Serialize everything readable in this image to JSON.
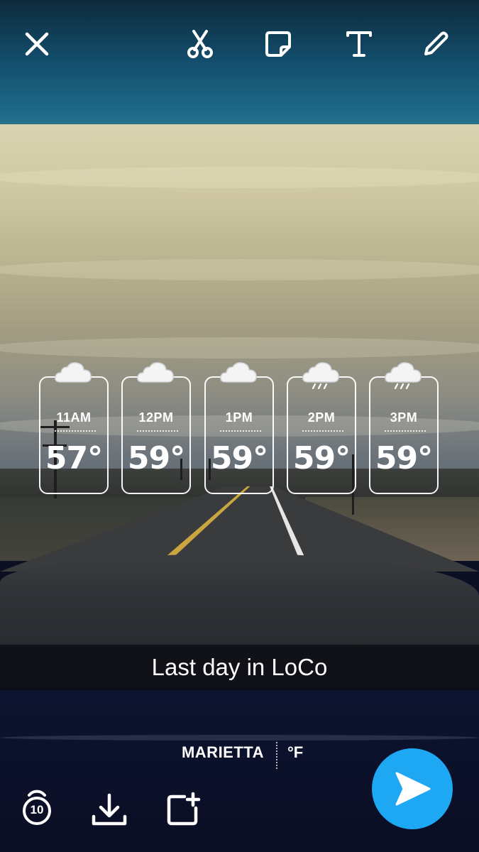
{
  "toolbar": {
    "close_icon": "close-icon",
    "scissors_icon": "scissors-icon",
    "sticker_icon": "sticker-icon",
    "text_icon": "text-icon",
    "pencil_icon": "pencil-icon"
  },
  "weather": {
    "hours": [
      {
        "time": "11AM",
        "temp": "57°",
        "icon": "cloud-icon"
      },
      {
        "time": "12PM",
        "temp": "59°",
        "icon": "cloud-icon"
      },
      {
        "time": "1PM",
        "temp": "59°",
        "icon": "cloud-icon"
      },
      {
        "time": "2PM",
        "temp": "59°",
        "icon": "rain-cloud-icon"
      },
      {
        "time": "3PM",
        "temp": "59°",
        "icon": "rain-cloud-icon"
      }
    ]
  },
  "caption": {
    "text": "Last day in LoCo"
  },
  "location": {
    "city": "MARIETTA",
    "unit": "°F"
  },
  "bottom_bar": {
    "timer_value": "10",
    "timer_icon": "timer-icon",
    "save_icon": "download-icon",
    "story_icon": "add-to-story-icon",
    "send_icon": "send-icon"
  },
  "colors": {
    "send_button": "#1ea7f2",
    "card_border": "#ffffff"
  }
}
